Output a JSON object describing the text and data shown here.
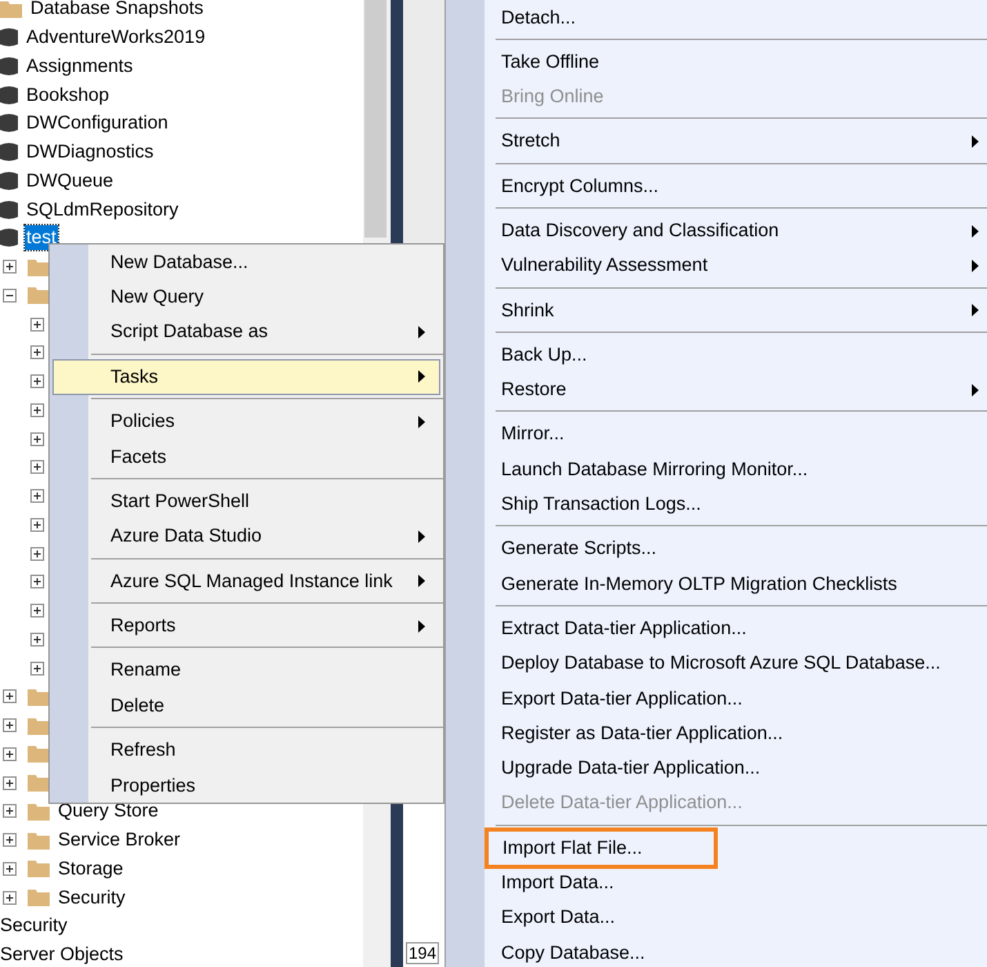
{
  "tree": {
    "database_nodes": [
      {
        "label": "Database Snapshots",
        "kind": "folder",
        "selected": false
      },
      {
        "label": "AdventureWorks2019",
        "kind": "database",
        "selected": false
      },
      {
        "label": "Assignments",
        "kind": "database",
        "selected": false
      },
      {
        "label": "Bookshop",
        "kind": "database",
        "selected": false
      },
      {
        "label": "DWConfiguration",
        "kind": "database",
        "selected": false
      },
      {
        "label": "DWDiagnostics",
        "kind": "database",
        "selected": false
      },
      {
        "label": "DWQueue",
        "kind": "database",
        "selected": false
      },
      {
        "label": "SQLdmRepository",
        "kind": "database",
        "selected": false
      },
      {
        "label": "test",
        "kind": "database",
        "selected": true,
        "children": [
          {
            "kind": "folder",
            "expanded": false
          },
          {
            "kind": "folder",
            "expanded": true,
            "children": [
              {
                "expanded": false
              },
              {
                "expanded": false
              },
              {
                "expanded": false
              },
              {
                "expanded": false
              },
              {
                "expanded": false
              },
              {
                "expanded": false
              },
              {
                "expanded": false
              },
              {
                "expanded": false
              },
              {
                "expanded": false
              },
              {
                "expanded": false
              },
              {
                "expanded": false
              },
              {
                "expanded": false
              },
              {
                "expanded": false
              }
            ]
          },
          {
            "kind": "folder",
            "expanded": false
          },
          {
            "kind": "folder",
            "expanded": false
          },
          {
            "kind": "folder",
            "expanded": false
          },
          {
            "kind": "folder",
            "expanded": false
          },
          {
            "label": "Query Store",
            "kind": "folder",
            "expanded": false
          },
          {
            "label": "Service Broker",
            "kind": "folder",
            "expanded": false
          },
          {
            "label": "Storage",
            "kind": "folder",
            "expanded": false
          },
          {
            "label": "Security",
            "kind": "folder",
            "expanded": false
          }
        ]
      }
    ],
    "server_nodes": [
      {
        "label": "Security"
      },
      {
        "label": "Server Objects"
      }
    ]
  },
  "editor_pane": {
    "line_text": "194"
  },
  "context_menu": {
    "groups": [
      [
        {
          "label": "New Database...",
          "submenu": false,
          "selected": false
        },
        {
          "label": "New Query",
          "submenu": false,
          "selected": false
        },
        {
          "label": "Script Database as",
          "submenu": true,
          "selected": false
        }
      ],
      [
        {
          "label": "Tasks",
          "submenu": true,
          "selected": true
        }
      ],
      [
        {
          "label": "Policies",
          "submenu": true,
          "selected": false
        },
        {
          "label": "Facets",
          "submenu": false,
          "selected": false
        }
      ],
      [
        {
          "label": "Start PowerShell",
          "submenu": false,
          "selected": false
        },
        {
          "label": "Azure Data Studio",
          "submenu": true,
          "selected": false
        }
      ],
      [
        {
          "label": "Azure SQL Managed Instance link",
          "submenu": true,
          "selected": false
        }
      ],
      [
        {
          "label": "Reports",
          "submenu": true,
          "selected": false
        }
      ],
      [
        {
          "label": "Rename",
          "submenu": false,
          "selected": false
        },
        {
          "label": "Delete",
          "submenu": false,
          "selected": false
        }
      ],
      [
        {
          "label": "Refresh",
          "submenu": false,
          "selected": false
        },
        {
          "label": "Properties",
          "submenu": false,
          "selected": false
        }
      ]
    ]
  },
  "tasks_submenu": {
    "groups": [
      [
        {
          "label": "Detach...",
          "submenu": false,
          "disabled": false,
          "highlighted": false
        }
      ],
      [
        {
          "label": "Take Offline",
          "submenu": false,
          "disabled": false,
          "highlighted": false
        },
        {
          "label": "Bring Online",
          "submenu": false,
          "disabled": true,
          "highlighted": false
        }
      ],
      [
        {
          "label": "Stretch",
          "submenu": true,
          "disabled": false,
          "highlighted": false
        }
      ],
      [
        {
          "label": "Encrypt Columns...",
          "submenu": false,
          "disabled": false,
          "highlighted": false
        }
      ],
      [
        {
          "label": "Data Discovery and Classification",
          "submenu": true,
          "disabled": false,
          "highlighted": false
        },
        {
          "label": "Vulnerability Assessment",
          "submenu": true,
          "disabled": false,
          "highlighted": false
        }
      ],
      [
        {
          "label": "Shrink",
          "submenu": true,
          "disabled": false,
          "highlighted": false
        }
      ],
      [
        {
          "label": "Back Up...",
          "submenu": false,
          "disabled": false,
          "highlighted": false
        },
        {
          "label": "Restore",
          "submenu": true,
          "disabled": false,
          "highlighted": false
        }
      ],
      [
        {
          "label": "Mirror...",
          "submenu": false,
          "disabled": false,
          "highlighted": false
        },
        {
          "label": "Launch Database Mirroring Monitor...",
          "submenu": false,
          "disabled": false,
          "highlighted": false
        },
        {
          "label": "Ship Transaction Logs...",
          "submenu": false,
          "disabled": false,
          "highlighted": false
        }
      ],
      [
        {
          "label": "Generate Scripts...",
          "submenu": false,
          "disabled": false,
          "highlighted": false
        },
        {
          "label": "Generate In-Memory OLTP Migration Checklists",
          "submenu": false,
          "disabled": false,
          "highlighted": false
        }
      ],
      [
        {
          "label": "Extract Data-tier Application...",
          "submenu": false,
          "disabled": false,
          "highlighted": false
        },
        {
          "label": "Deploy Database to Microsoft Azure SQL Database...",
          "submenu": false,
          "disabled": false,
          "highlighted": false
        },
        {
          "label": "Export Data-tier Application...",
          "submenu": false,
          "disabled": false,
          "highlighted": false
        },
        {
          "label": "Register as Data-tier Application...",
          "submenu": false,
          "disabled": false,
          "highlighted": false
        },
        {
          "label": "Upgrade Data-tier Application...",
          "submenu": false,
          "disabled": false,
          "highlighted": false
        },
        {
          "label": "Delete Data-tier Application...",
          "submenu": false,
          "disabled": true,
          "highlighted": false
        }
      ],
      [
        {
          "label": "Import Flat File...",
          "submenu": false,
          "disabled": false,
          "highlighted": true
        },
        {
          "label": "Import Data...",
          "submenu": false,
          "disabled": false,
          "highlighted": false
        },
        {
          "label": "Export Data...",
          "submenu": false,
          "disabled": false,
          "highlighted": false
        },
        {
          "label": "Copy Database...",
          "submenu": false,
          "disabled": false,
          "highlighted": false
        }
      ]
    ]
  }
}
